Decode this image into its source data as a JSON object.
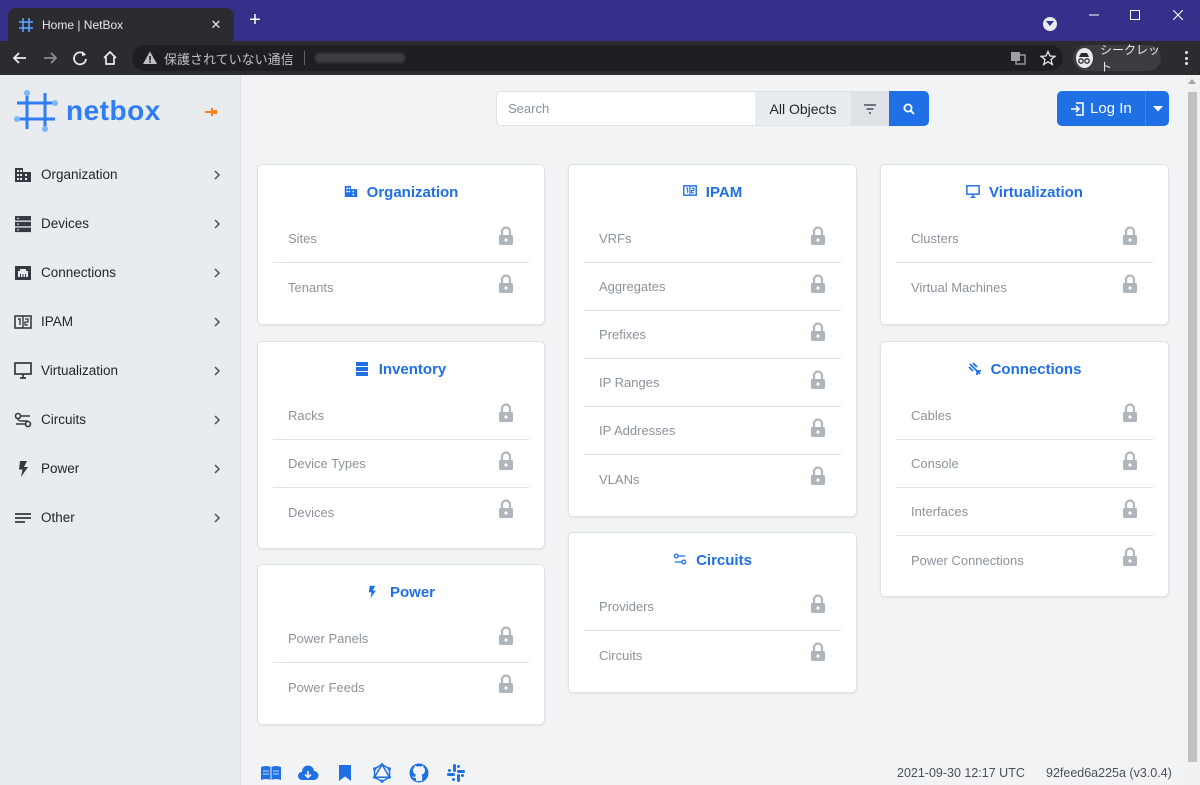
{
  "browser": {
    "tab_title": "Home | NetBox",
    "security_text": "保護されていない通信",
    "incognito_label": "シークレット"
  },
  "sidebar": {
    "brand": "netbox",
    "items": [
      {
        "label": "Organization",
        "icon": "domain-icon"
      },
      {
        "label": "Devices",
        "icon": "server-icon"
      },
      {
        "label": "Connections",
        "icon": "ethernet-icon"
      },
      {
        "label": "IPAM",
        "icon": "counter-icon"
      },
      {
        "label": "Virtualization",
        "icon": "monitor-icon"
      },
      {
        "label": "Circuits",
        "icon": "transit-connection-icon"
      },
      {
        "label": "Power",
        "icon": "flash-icon"
      },
      {
        "label": "Other",
        "icon": "notes-icon"
      }
    ]
  },
  "search": {
    "placeholder": "Search",
    "object_type": "All Objects"
  },
  "login": {
    "label": "Log In"
  },
  "cards": {
    "organization": {
      "title": "Organization",
      "rows": [
        "Sites",
        "Tenants"
      ]
    },
    "inventory": {
      "title": "Inventory",
      "rows": [
        "Racks",
        "Device Types",
        "Devices"
      ]
    },
    "power": {
      "title": "Power",
      "rows": [
        "Power Panels",
        "Power Feeds"
      ]
    },
    "ipam": {
      "title": "IPAM",
      "rows": [
        "VRFs",
        "Aggregates",
        "Prefixes",
        "IP Ranges",
        "IP Addresses",
        "VLANs"
      ]
    },
    "circuits": {
      "title": "Circuits",
      "rows": [
        "Providers",
        "Circuits"
      ]
    },
    "virtualization": {
      "title": "Virtualization",
      "rows": [
        "Clusters",
        "Virtual Machines"
      ]
    },
    "connections": {
      "title": "Connections",
      "rows": [
        "Cables",
        "Console",
        "Interfaces",
        "Power Connections"
      ]
    }
  },
  "footer": {
    "timestamp": "2021-09-30 12:17 UTC",
    "version": "92feed6a225a (v3.0.4)",
    "icons": [
      "book-icon",
      "cloud-download-icon",
      "bookmark-icon",
      "graphql-icon",
      "github-icon",
      "slack-icon"
    ]
  },
  "colors": {
    "accent": "#1f6fe5",
    "brand": "#2f7cf6",
    "titlebar": "#35318a",
    "muted_text": "#8a939b",
    "lock": "#adb5bd"
  }
}
